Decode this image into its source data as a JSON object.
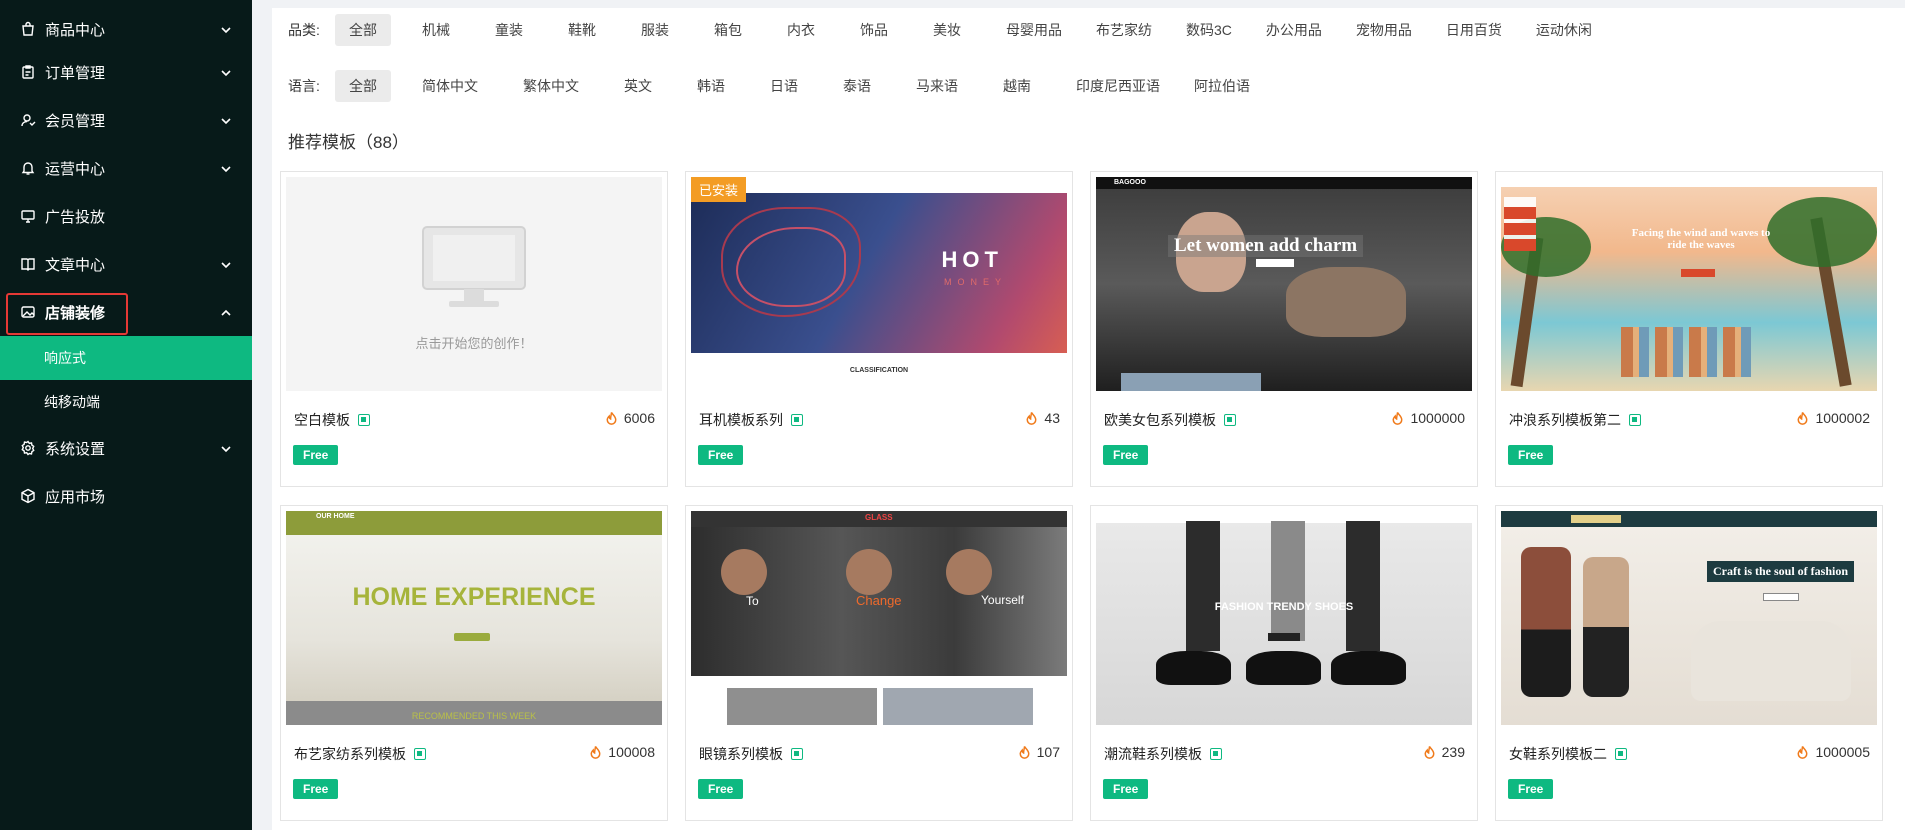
{
  "sidebar": {
    "items": [
      {
        "label": "商品中心",
        "icon": "bag-icon",
        "has_children": true
      },
      {
        "label": "订单管理",
        "icon": "clipboard-icon",
        "has_children": true
      },
      {
        "label": "会员管理",
        "icon": "member-icon",
        "has_children": true
      },
      {
        "label": "运营中心",
        "icon": "bell-icon",
        "has_children": true
      },
      {
        "label": "广告投放",
        "icon": "monitor-icon",
        "has_children": false
      },
      {
        "label": "文章中心",
        "icon": "book-icon",
        "has_children": true
      },
      {
        "label": "店铺装修",
        "icon": "picture-icon",
        "has_children": true,
        "expanded": true
      },
      {
        "label": "系统设置",
        "icon": "gear-icon",
        "has_children": true
      },
      {
        "label": "应用市场",
        "icon": "cube-icon",
        "has_children": false
      }
    ],
    "subitems": [
      {
        "label": "响应式",
        "active": true
      },
      {
        "label": "纯移动端",
        "active": false
      }
    ]
  },
  "filters": {
    "category_label": "品类:",
    "categories": [
      "全部",
      "机械",
      "童装",
      "鞋靴",
      "服装",
      "箱包",
      "内衣",
      "饰品",
      "美妆",
      "母婴用品",
      "布艺家纺",
      "数码3C",
      "办公用品",
      "宠物用品",
      "日用百货",
      "运动休闲"
    ],
    "category_selected": "全部",
    "language_label": "语言:",
    "languages": [
      "全部",
      "简体中文",
      "繁体中文",
      "英文",
      "韩语",
      "日语",
      "泰语",
      "马来语",
      "越南",
      "印度尼西亚语",
      "阿拉伯语"
    ],
    "language_selected": "全部"
  },
  "section": {
    "title": "推荐模板（88）"
  },
  "templates": [
    {
      "name": "空白模板",
      "heat": "6006",
      "badge": "Free",
      "art": "blank",
      "caption": "点击开始您的创作！"
    },
    {
      "name": "耳机模板系列",
      "heat": "43",
      "badge": "Free",
      "art": "hot",
      "installed": "已安装",
      "hero_title": "HOT",
      "hero_sub": "MONEY",
      "section_text": "CLASSIFICATION"
    },
    {
      "name": "欧美女包系列模板",
      "heat": "1000000",
      "badge": "Free",
      "art": "bag",
      "brand": "BAGOOO",
      "hero_title": "Let women add charm"
    },
    {
      "name": "冲浪系列模板第二",
      "heat": "1000002",
      "badge": "Free",
      "art": "surf",
      "hero_title": "Facing the wind and waves to ride the waves"
    },
    {
      "name": "布艺家纺系列模板",
      "heat": "100008",
      "badge": "Free",
      "art": "home",
      "brand": "OUR HOME",
      "hero_title": "HOME EXPERIENCE",
      "section_text": "RECOMMENDED THIS WEEK"
    },
    {
      "name": "眼镜系列模板",
      "heat": "107",
      "badge": "Free",
      "art": "glass",
      "brand": "GLASS",
      "words": [
        "To",
        "Change",
        "Yourself"
      ]
    },
    {
      "name": "潮流鞋系列模板",
      "heat": "239",
      "badge": "Free",
      "art": "shoes",
      "hero_title": "FASHION TRENDY SHOES"
    },
    {
      "name": "女鞋系列模板二",
      "heat": "1000005",
      "badge": "Free",
      "art": "dress",
      "hero_title": "Craft is the soul of fashion"
    }
  ],
  "colors": {
    "accent": "#0eb981",
    "sidebar_bg": "#071a19",
    "installed": "#f39c24",
    "highlight_border": "#e53935"
  }
}
